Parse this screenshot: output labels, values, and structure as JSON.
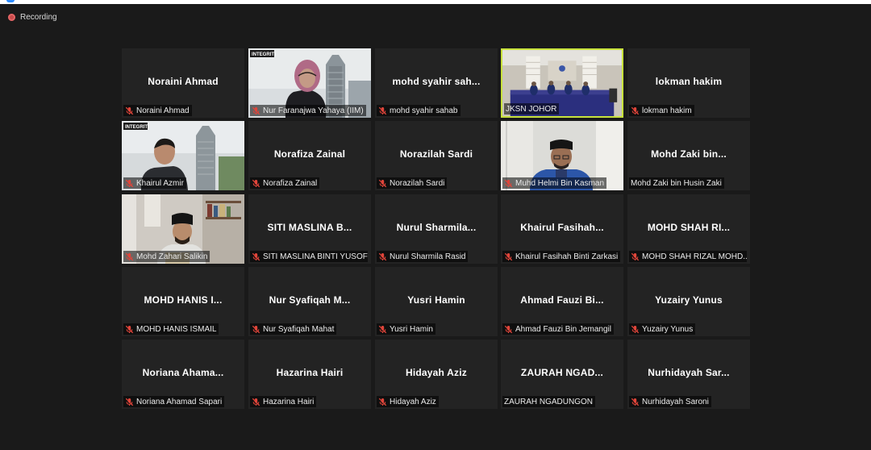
{
  "recording": {
    "label": "Recording"
  },
  "tiles": [
    {
      "big": "Noraini Ahmad",
      "label": "Noraini Ahmad",
      "muted": true
    },
    {
      "big": "",
      "label": "Nur Faranajwa Yahaya (IIM)",
      "muted": true,
      "video": "woman-hijab",
      "logo": "INTEGRITI"
    },
    {
      "big": "mohd syahir sah...",
      "label": "mohd syahir sahab",
      "muted": true
    },
    {
      "big": "",
      "label": "JKSN JOHOR",
      "muted": false,
      "video": "meeting-room",
      "speaker": true
    },
    {
      "big": "lokman hakim",
      "label": "lokman hakim",
      "muted": true
    },
    {
      "big": "",
      "label": "Khairul Azmir",
      "muted": true,
      "video": "man-building",
      "logo": "INTEGRITI"
    },
    {
      "big": "Norafiza Zainal",
      "label": "Norafiza Zainal",
      "muted": true
    },
    {
      "big": "Norazilah Sardi",
      "label": "Norazilah Sardi",
      "muted": true
    },
    {
      "big": "",
      "label": "Muhd Helmi Bin Kasman",
      "muted": true,
      "video": "man-songkok"
    },
    {
      "big": "Mohd Zaki bin...",
      "label": "Mohd Zaki bin Husin Zaki",
      "muted": false
    },
    {
      "big": "",
      "label": "Mohd Zahari Salikin",
      "muted": true,
      "video": "man-room"
    },
    {
      "big": "SITI MASLINA B...",
      "label": "SITI MASLINA BINTI YUSOFF",
      "muted": true
    },
    {
      "big": "Nurul Sharmila...",
      "label": "Nurul Sharmila Rasid",
      "muted": true
    },
    {
      "big": "Khairul Fasihah...",
      "label": "Khairul Fasihah Binti Zarkasi",
      "muted": true
    },
    {
      "big": "MOHD SHAH RI...",
      "label": "MOHD SHAH RIZAL MOHD...",
      "muted": true
    },
    {
      "big": "MOHD HANIS I...",
      "label": "MOHD HANIS ISMAIL",
      "muted": true
    },
    {
      "big": "Nur Syafiqah M...",
      "label": "Nur Syafiqah Mahat",
      "muted": true
    },
    {
      "big": "Yusri Hamin",
      "label": "Yusri Hamin",
      "muted": true
    },
    {
      "big": "Ahmad Fauzi Bi...",
      "label": "Ahmad Fauzi Bin Jemangil",
      "muted": true
    },
    {
      "big": "Yuzairy Yunus",
      "label": "Yuzairy Yunus",
      "muted": true
    },
    {
      "big": "Noriana Ahama...",
      "label": "Noriana Ahamad Sapari",
      "muted": true
    },
    {
      "big": "Hazarina Hairi",
      "label": "Hazarina Hairi",
      "muted": true
    },
    {
      "big": "Hidayah Aziz",
      "label": "Hidayah Aziz",
      "muted": true
    },
    {
      "big": "ZAURAH NGAD...",
      "label": "ZAURAH NGADUNGON",
      "muted": false
    },
    {
      "big": "Nurhidayah Sar...",
      "label": "Nurhidayah Saroni",
      "muted": true
    }
  ],
  "colors": {
    "background": "#1a1a1a",
    "tile": "#232323",
    "speaker_border": "#c8e23c",
    "mic_muted": "#e0453a"
  }
}
